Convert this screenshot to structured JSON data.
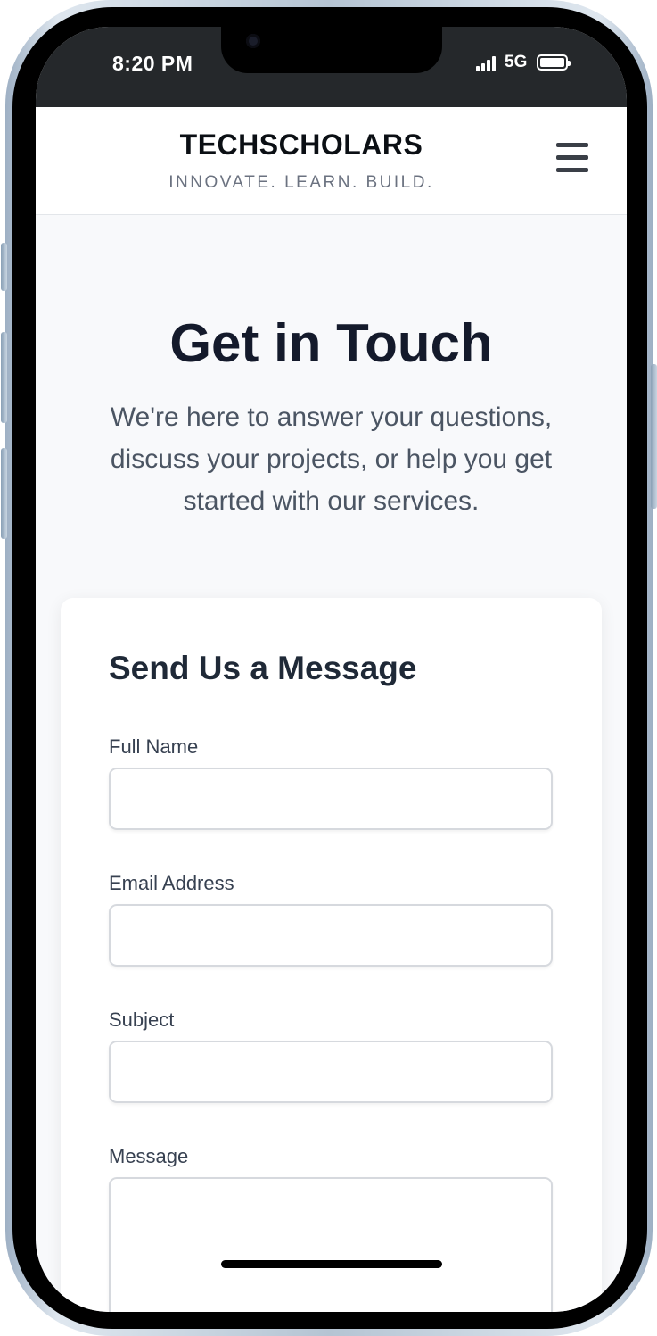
{
  "status_bar": {
    "time": "8:20 PM",
    "network": "5G"
  },
  "header": {
    "brand": "TECHSCHOLARS",
    "tagline": "INNOVATE. LEARN. BUILD.",
    "menu_icon": "hamburger-menu-icon"
  },
  "hero": {
    "title": "Get in Touch",
    "description": "We're here to answer your questions, discuss your projects, or help you get started with our services."
  },
  "contact_form": {
    "title": "Send Us a Message",
    "fields": [
      {
        "label": "Full Name",
        "value": ""
      },
      {
        "label": "Email Address",
        "value": ""
      },
      {
        "label": "Subject",
        "value": ""
      },
      {
        "label": "Message",
        "value": ""
      }
    ]
  },
  "colors": {
    "status_bar_bg": "#25282b",
    "page_bg": "#f8f9fb",
    "title_text": "#141a2b",
    "body_text": "#4b5563"
  }
}
